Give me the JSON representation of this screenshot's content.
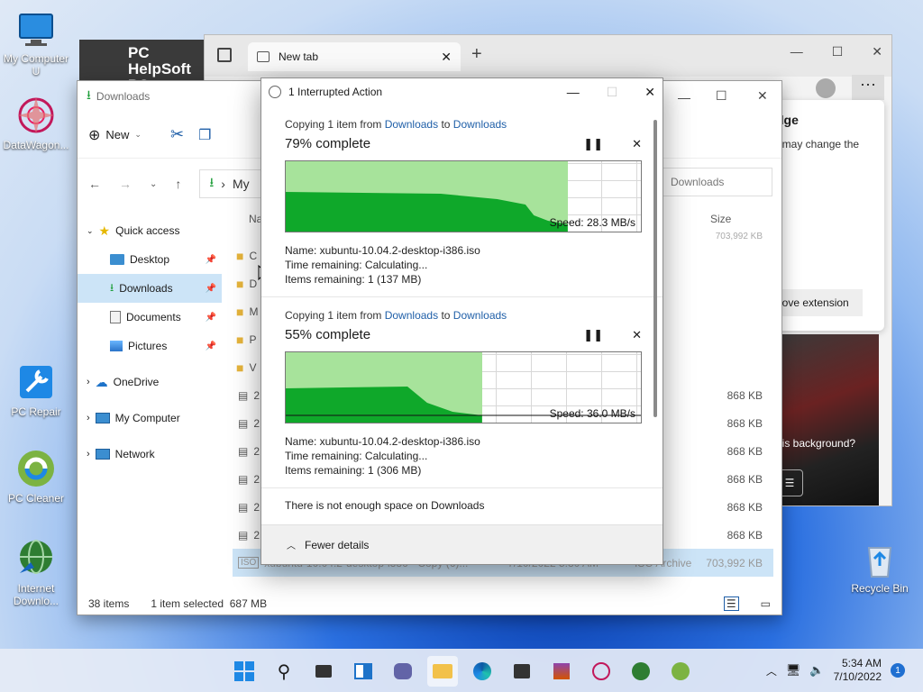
{
  "desktop": {
    "icons": [
      {
        "label": "My Computer U"
      },
      {
        "label": "DataWagon..."
      },
      {
        "label": "PC Repair"
      },
      {
        "label": "PC Cleaner"
      },
      {
        "label": "Internet Downlo..."
      },
      {
        "label": "Recycle Bin"
      }
    ],
    "banner": "PC HelpSoft PC Cleaner"
  },
  "browser": {
    "tab_label": "New tab",
    "side_heading": "dge",
    "side_text": "t may change the",
    "side_button": "nove extension",
    "photo_question": "his background?"
  },
  "explorer": {
    "title": "Downloads",
    "toolbar": {
      "new_label": "New"
    },
    "address": {
      "path": "My",
      "search_placeholder": "Downloads"
    },
    "nav": {
      "quick_access": "Quick access",
      "desktop": "Desktop",
      "downloads": "Downloads",
      "documents": "Documents",
      "pictures": "Pictures",
      "onedrive": "OneDrive",
      "mycomputer": "My Computer",
      "network": "Network"
    },
    "columns": {
      "name": "Na",
      "size": "Size"
    },
    "rows": [
      {
        "name": "",
        "size": "703,992 KB"
      },
      {
        "name": "C",
        "size": ""
      },
      {
        "name": "D",
        "size": ""
      },
      {
        "name": "M",
        "size": ""
      },
      {
        "name": "P",
        "size": ""
      },
      {
        "name": "V",
        "size": ""
      },
      {
        "name": "2",
        "size": "868 KB"
      },
      {
        "name": "2",
        "size": "868 KB"
      },
      {
        "name": "2",
        "size": "868 KB"
      },
      {
        "name": "2",
        "size": "868 KB"
      },
      {
        "name": "2",
        "size": "868 KB"
      },
      {
        "name": "2",
        "size": "868 KB"
      }
    ],
    "selected_row": {
      "name": "xubuntu-10.04.2-desktop-i386 - Copy (6)...",
      "date": "7/10/2022 5:30 AM",
      "type": "ISO Archive",
      "size": "703,992 KB"
    },
    "status": {
      "count": "38 items",
      "selected": "1 item selected",
      "selected_size": "687 MB"
    }
  },
  "dialog": {
    "title": "1 Interrupted Action",
    "ops": [
      {
        "copy_prefix": "Copying 1 item from",
        "from": "Downloads",
        "to_word": "to",
        "to": "Downloads",
        "percent_text": "79% complete",
        "progress": 0.79,
        "speed": "Speed: 28.3 MB/s",
        "name": "Name:  xubuntu-10.04.2-desktop-i386.iso",
        "time": "Time remaining:  Calculating...",
        "items": "Items remaining:  1 (137 MB)"
      },
      {
        "copy_prefix": "Copying 1 item from",
        "from": "Downloads",
        "to_word": "to",
        "to": "Downloads",
        "percent_text": "55% complete",
        "progress": 0.55,
        "speed": "Speed: 36.0 MB/s",
        "name": "Name:  xubuntu-10.04.2-desktop-i386.iso",
        "time": "Time remaining:  Calculating...",
        "items": "Items remaining:  1 (306 MB)"
      }
    ],
    "message": "There is not enough space on Downloads",
    "fewer_details": "Fewer details"
  },
  "taskbar": {
    "time": "5:34 AM",
    "date": "7/10/2022",
    "notification_count": "1"
  },
  "colors": {
    "accent": "#1f5fa8",
    "progress_fill": "#a7e39b",
    "progress_graph": "#0fa82a",
    "selection": "#cce4f7"
  }
}
